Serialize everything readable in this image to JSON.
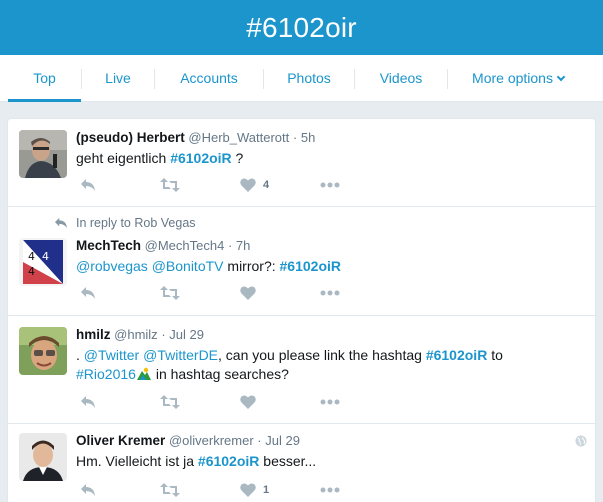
{
  "banner": {
    "title": "#6102oir"
  },
  "tabs": [
    {
      "label": "Top",
      "active": true
    },
    {
      "label": "Live"
    },
    {
      "label": "Accounts"
    },
    {
      "label": "Photos"
    },
    {
      "label": "Videos"
    },
    {
      "label": "More options"
    }
  ],
  "colors": {
    "brand": "#1b95cc",
    "text": "#14171a",
    "muted": "#657786",
    "background": "#e6ecf0",
    "border": "#e1e8ed"
  },
  "tweets": [
    {
      "fullname": "(pseudo) Herbert",
      "handle": "@Herb_Watterott",
      "dot": "·",
      "time": "5h",
      "text_plain1": "geht eigentlich ",
      "hashtag": "#6102oiR",
      "text_plain2": " ?",
      "like_count": "4"
    },
    {
      "reply_context": "In reply to Rob Vegas",
      "fullname": "MechTech",
      "handle": "@MechTech4",
      "dot": "·",
      "time": "7h",
      "mention1": "@robvegas",
      "mention2": "@BonitoTV",
      "text_plain1": " mirror?: ",
      "hashtag": "#6102oiR"
    },
    {
      "fullname": "hmilz",
      "handle": "@hmilz",
      "dot": "·",
      "time": "Jul 29",
      "text_lead": ". ",
      "mention1": "@Twitter",
      "mention2": "@TwitterDE",
      "text_plain1": ", can you please link the hashtag ",
      "hashtag": "#6102oiR",
      "text_plain2": " to",
      "hashtag2": "#Rio2016",
      "text_plain3": " in hashtag searches?"
    },
    {
      "fullname": "Oliver Kremer",
      "handle": "@oliverkremer",
      "dot": "·",
      "time": "Jul 29",
      "text_plain1": "Hm. Vielleicht ist ja ",
      "hashtag": "#6102oiR",
      "text_plain2": " besser...",
      "like_count": "1"
    }
  ]
}
